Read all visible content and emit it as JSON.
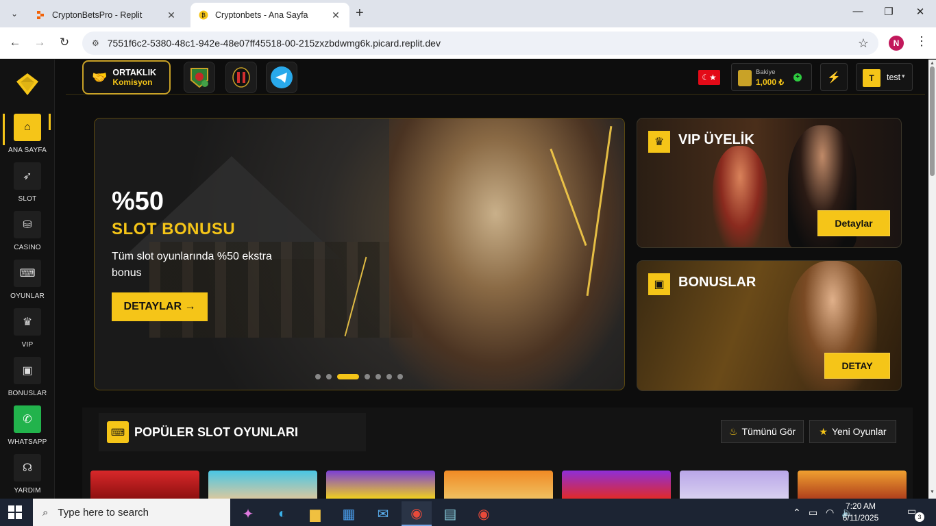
{
  "browser": {
    "tabs": [
      {
        "title": "CryptonBetsPro - Replit",
        "close": "✕"
      },
      {
        "title": "Cryptonbets - Ana Sayfa",
        "close": "✕"
      }
    ],
    "new_tab": "+",
    "url": "7551f6c2-5380-48c1-942e-48e07ff45518-00-215zxzbdwmg6k.picard.replit.dev",
    "profile_initial": "N"
  },
  "sidebar": {
    "items": [
      {
        "label": "ANA SAYFA",
        "icon": "home-icon",
        "glyph": "⌂"
      },
      {
        "label": "SLOT",
        "icon": "rocket-icon",
        "glyph": "➶"
      },
      {
        "label": "CASINO",
        "icon": "chips-icon",
        "glyph": "⛁"
      },
      {
        "label": "OYUNLAR",
        "icon": "gamepad-icon",
        "glyph": "⌨"
      },
      {
        "label": "VIP",
        "icon": "crown-icon",
        "glyph": "♛"
      },
      {
        "label": "BONUSLAR",
        "icon": "gift-icon",
        "glyph": "▣"
      },
      {
        "label": "WHATSAPP",
        "icon": "whatsapp-icon",
        "glyph": "✆"
      },
      {
        "label": "YARDIM",
        "icon": "headset-icon",
        "glyph": "☊"
      }
    ]
  },
  "topbar": {
    "partner": {
      "line1": "ORTAKLIK",
      "line2": "Komisyon"
    },
    "flag_glyph": "☾★",
    "balance": {
      "label": "Bakiye",
      "value": "1,000 ₺",
      "add": "+"
    },
    "bolt": "⚡",
    "user": {
      "initial": "T",
      "name": "test",
      "caret": "▾"
    }
  },
  "hero": {
    "headline": "%50",
    "subheadline": "SLOT BONUSU",
    "description": "Tüm slot oyunlarında %50 ekstra bonus",
    "button": "DETAYLAR →",
    "slides": 7,
    "active_slide": 3
  },
  "cards": {
    "vip": {
      "title": "VIP ÜYELİK",
      "button": "Detaylar",
      "icon": "crown-icon"
    },
    "bonus": {
      "title": "BONUSLAR",
      "button": "DETAY",
      "icon": "gift-icon"
    }
  },
  "popular": {
    "title": "POPÜLER SLOT OYUNLARI",
    "see_all": "Tümünü Gör",
    "new_games": "Yeni Oyunlar",
    "game_colors": [
      "#d8282a",
      "#49c6e5",
      "#7b3fd6",
      "#f08a24",
      "#8e2fd8",
      "#b9a6e8",
      "#f0a030"
    ]
  },
  "taskbar": {
    "search_placeholder": "Type here to search",
    "time": "7:20 AM",
    "date": "6/11/2025",
    "notifications": "3"
  }
}
